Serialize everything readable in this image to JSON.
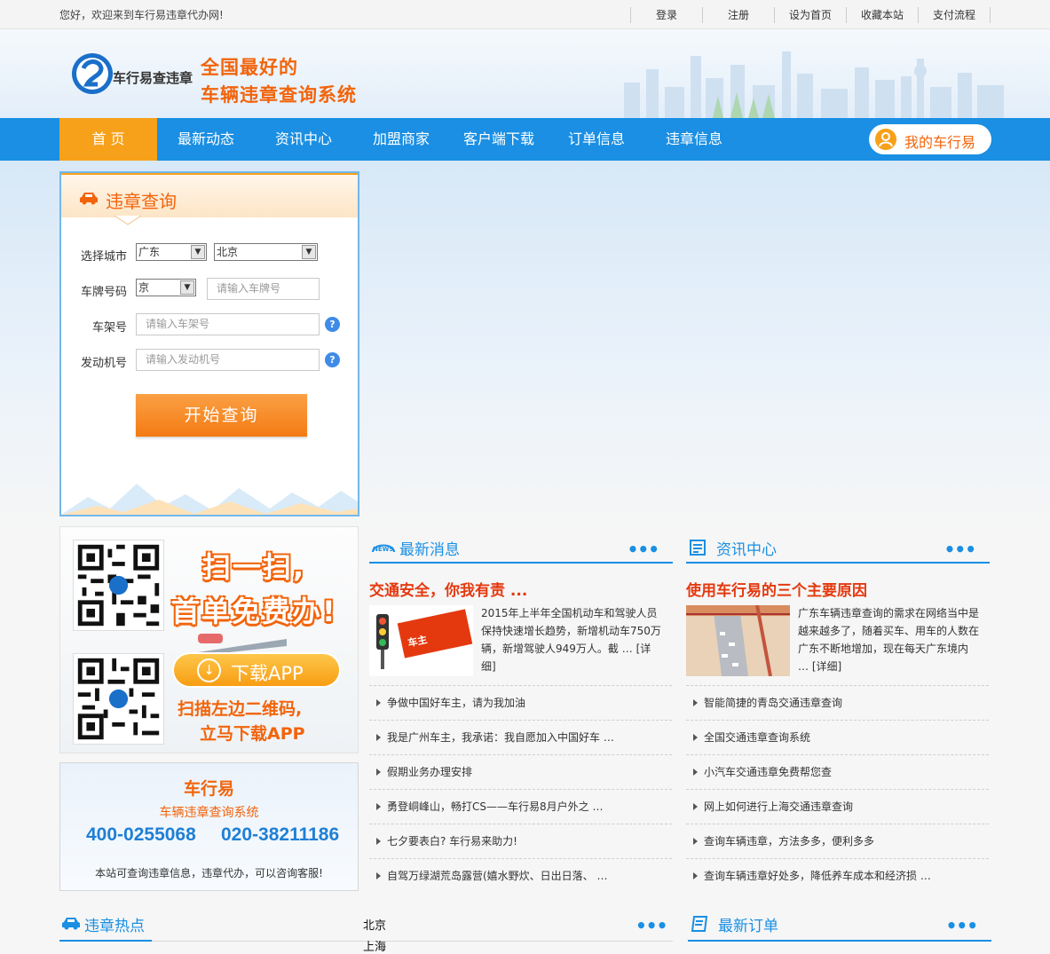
{
  "topbar": {
    "welcome": "您好，欢迎来到车行易违章代办网!",
    "links": [
      "登录",
      "注册",
      "设为首页",
      "收藏本站",
      "支付流程"
    ]
  },
  "header": {
    "brand": "车行易查违章",
    "slogan_line1": "全国最好的",
    "slogan_line2": "车辆违章查询系统"
  },
  "nav": {
    "items": [
      "首 页",
      "最新动态",
      "资讯中心",
      "加盟商家",
      "客户端下载",
      "订单信息",
      "违章信息"
    ],
    "active_index": 0,
    "my_account": "我的车行易"
  },
  "query": {
    "title": "违章查询",
    "city_label": "选择城市",
    "province_value": "广东",
    "city_value": "北京",
    "plate_label": "车牌号码",
    "plate_prefix": "京",
    "plate_placeholder": "请输入车牌号",
    "frame_label": "车架号",
    "frame_placeholder": "请输入车架号",
    "engine_label": "发动机号",
    "engine_placeholder": "请输入发动机号",
    "help_glyph": "?",
    "submit": "开始查询"
  },
  "promo": {
    "line1": "扫一扫,",
    "line2": "首单免费办!",
    "download": "下载APP",
    "line3": "扫描左边二维码,",
    "line4": "立马下载APP"
  },
  "contact": {
    "brand": "车行易",
    "subtitle": "车辆违章查询系统",
    "tel1": "400-0255068",
    "tel2": "020-38211186",
    "note": "本站可查询违章信息，违章代办，可以咨询客服!"
  },
  "news": {
    "title": "最新消息",
    "more": "•••",
    "headline": "交通安全，你我有责 ...",
    "summary": "2015年上半年全国机动车和驾驶人员保持快速增长趋势，新增机动车750万辆，新增驾驶人949万人。截 …",
    "detail": "[详细]",
    "items": [
      "争做中国好车主，请为我加油",
      "我是广州车主，我承诺：我自愿加入中国好车 …",
      "假期业务办理安排",
      "勇登峒峰山，畅打CS——车行易8月户外之 …",
      "七夕要表白? 车行易来助力!",
      "自驾万绿湖荒岛露营(嬉水野炊、日出日落、 …"
    ]
  },
  "info": {
    "title": "资讯中心",
    "more": "•••",
    "headline": "使用车行易的三个主要原因",
    "summary": "广东车辆违章查询的需求在网络当中是越来越多了，随着买车、用车的人数在广东不断地增加，现在每天广东境内 …",
    "detail": "[详细]",
    "items": [
      "智能简捷的青岛交通违章查询",
      "全国交通违章查询系统",
      "小汽车交通违章免费帮您查",
      "网上如何进行上海交通违章查询",
      "查询车辆违章，方法多多，便利多多",
      "查询车辆违章好处多，降低养车成本和经济损 …"
    ]
  },
  "hot": {
    "title": "违章热点",
    "more": "•••"
  },
  "orders": {
    "title": "最新订单",
    "more": "•••"
  },
  "cities": [
    "北京",
    "上海"
  ],
  "colors": {
    "primary": "#1a8fe3",
    "accent": "#f7a11a",
    "headline_red": "#e4390f",
    "slogan": "#f2640b"
  }
}
